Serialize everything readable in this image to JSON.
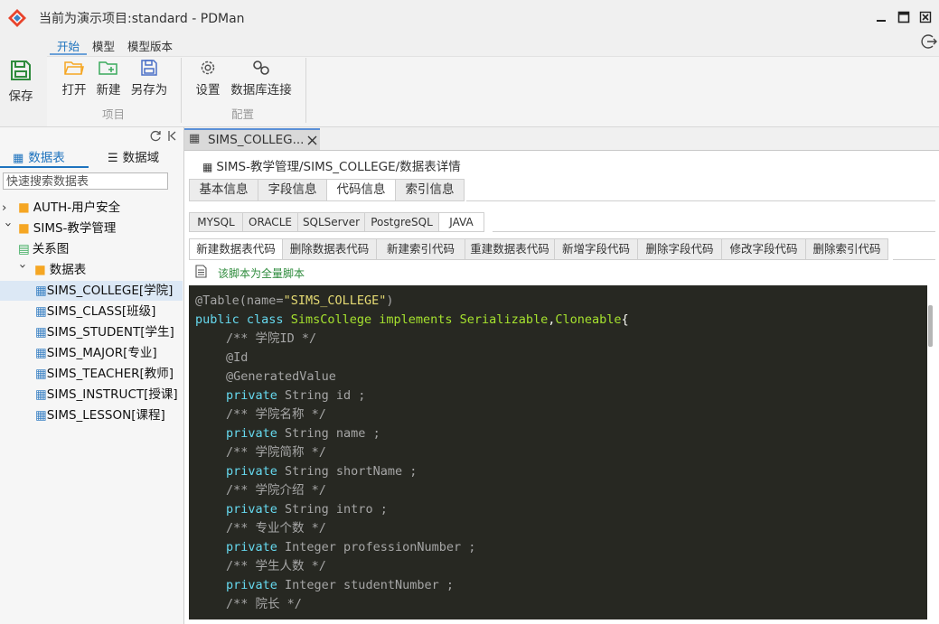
{
  "window": {
    "title": "当前为演示项目:standard - PDMan"
  },
  "menu": {
    "tabs": [
      "开始",
      "模型",
      "模型版本"
    ]
  },
  "ribbon": {
    "save": "保存",
    "open": "打开",
    "new": "新建",
    "saveas": "另存为",
    "group_project": "项目",
    "settings": "设置",
    "dbconn": "数据库连接",
    "group_config": "配置"
  },
  "left": {
    "tab_tables": "数据表",
    "tab_domains": "数据域",
    "search_placeholder": "快速搜索数据表",
    "tree": [
      "AUTH-用户安全",
      "SIMS-教学管理",
      "关系图",
      "数据表",
      "SIMS_COLLEGE[学院]",
      "SIMS_CLASS[班级]",
      "SIMS_STUDENT[学生]",
      "SIMS_MAJOR[专业]",
      "SIMS_TEACHER[教师]",
      "SIMS_INSTRUCT[授课]",
      "SIMS_LESSON[课程]"
    ]
  },
  "doc_tab": {
    "label": "SIMS_COLLEG..."
  },
  "breadcrumb": "SIMS-教学管理/SIMS_COLLEGE/数据表详情",
  "section_tabs": [
    "基本信息",
    "字段信息",
    "代码信息",
    "索引信息"
  ],
  "db_tabs": [
    "MYSQL",
    "ORACLE",
    "SQLServer",
    "PostgreSQL",
    "JAVA"
  ],
  "code_tabs": [
    "新建数据表代码",
    "删除数据表代码",
    "新建索引代码",
    "重建数据表代码",
    "新增字段代码",
    "删除字段代码",
    "修改字段代码",
    "删除索引代码"
  ],
  "script_note": "该脚本为全量脚本",
  "code": {
    "annotation": "@Table",
    "annotation_open": "(name=",
    "annotation_value": "\"SIMS_COLLEGE\"",
    "annotation_close": ")",
    "kw_public": "public",
    "kw_class": "class",
    "class_name": "SimsCollege",
    "kw_implements": "implements",
    "interfaces": "Serializable",
    "iface_sep": ",",
    "iface2": "Cloneable",
    "brace": "{",
    "lines": [
      "/** 学院ID */",
      "@Id",
      "@GeneratedValue",
      "private String id ;",
      "/** 学院名称 */",
      "private String name ;",
      "/** 学院简称 */",
      "private String shortName ;",
      "/** 学院介绍 */",
      "private String intro ;",
      "/** 专业个数 */",
      "private Integer professionNumber ;",
      "/** 学生人数 */",
      "private Integer studentNumber ;",
      "/** 院长 */"
    ]
  },
  "colors": {
    "accent": "#1e73be",
    "code_bg": "#272822",
    "keyword": "#66d9ef",
    "string": "#e6db74",
    "plain": "#a6a6a6",
    "green_icon": "#2e8b3c",
    "folder": "#f5a623"
  }
}
